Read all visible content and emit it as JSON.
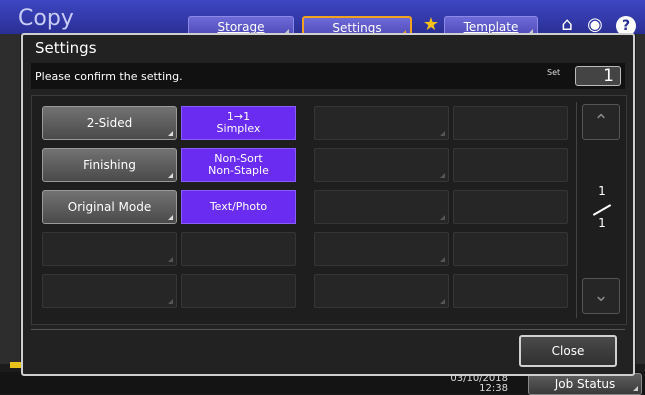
{
  "app": {
    "title": "Copy",
    "tabs": [
      {
        "label": "Storage"
      },
      {
        "label": "Settings",
        "active": true
      },
      {
        "label": "Template"
      }
    ],
    "icons": [
      "star-icon",
      "home-icon",
      "globe-icon",
      "help-icon"
    ],
    "help_glyph": "?"
  },
  "status_bar": {
    "date": "03/10/2018",
    "time": "12:38",
    "job_status_label": "Job Status"
  },
  "dialog": {
    "title": "Settings",
    "message": "Please confirm the setting.",
    "set_label": "Set",
    "set_value": "1",
    "rows": [
      {
        "label": "2-Sided",
        "value_line1": "1→1",
        "value_line2": "Simplex"
      },
      {
        "label": "Finishing",
        "value_line1": "Non-Sort",
        "value_line2": "Non-Staple"
      },
      {
        "label": "Original Mode",
        "value_line1": "Text/Photo",
        "value_line2": ""
      }
    ],
    "page_current": "1",
    "page_total": "1",
    "close_label": "Close"
  },
  "colors": {
    "accent": "#6a2cf0",
    "top_bar": "#2a2f94",
    "active_tab_border": "#f1a21e"
  }
}
